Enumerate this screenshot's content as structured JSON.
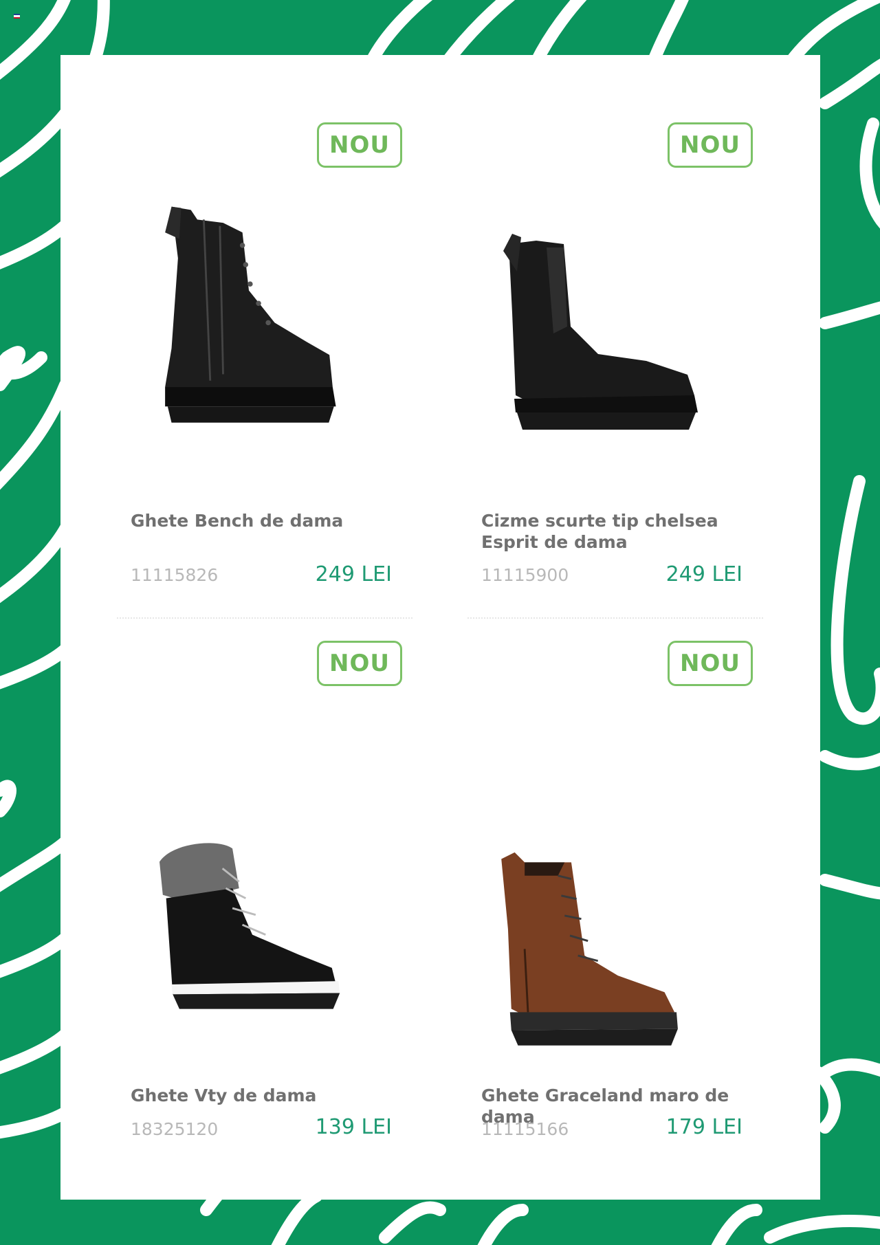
{
  "theme": {
    "background": "#0a955d",
    "accent_green": "#6fb85a",
    "price_color": "#1f9a73"
  },
  "products": [
    {
      "badge": "NOU",
      "title": "Ghete Bench de dama",
      "code": "11115826",
      "price": "249 LEI",
      "image": "black-lace-up-boot"
    },
    {
      "badge": "NOU",
      "title": "Cizme scurte tip chelsea Esprit de dama",
      "code": "11115900",
      "price": "249 LEI",
      "image": "black-chelsea-boot"
    },
    {
      "badge": "NOU",
      "title": "Ghete Vty de dama",
      "code": "18325120",
      "price": "139 LEI",
      "image": "black-fur-cuff-boot"
    },
    {
      "badge": "NOU",
      "title": "Ghete Graceland maro de dama",
      "code": "11115166",
      "price": "179 LEI",
      "image": "brown-lace-up-boot"
    }
  ]
}
